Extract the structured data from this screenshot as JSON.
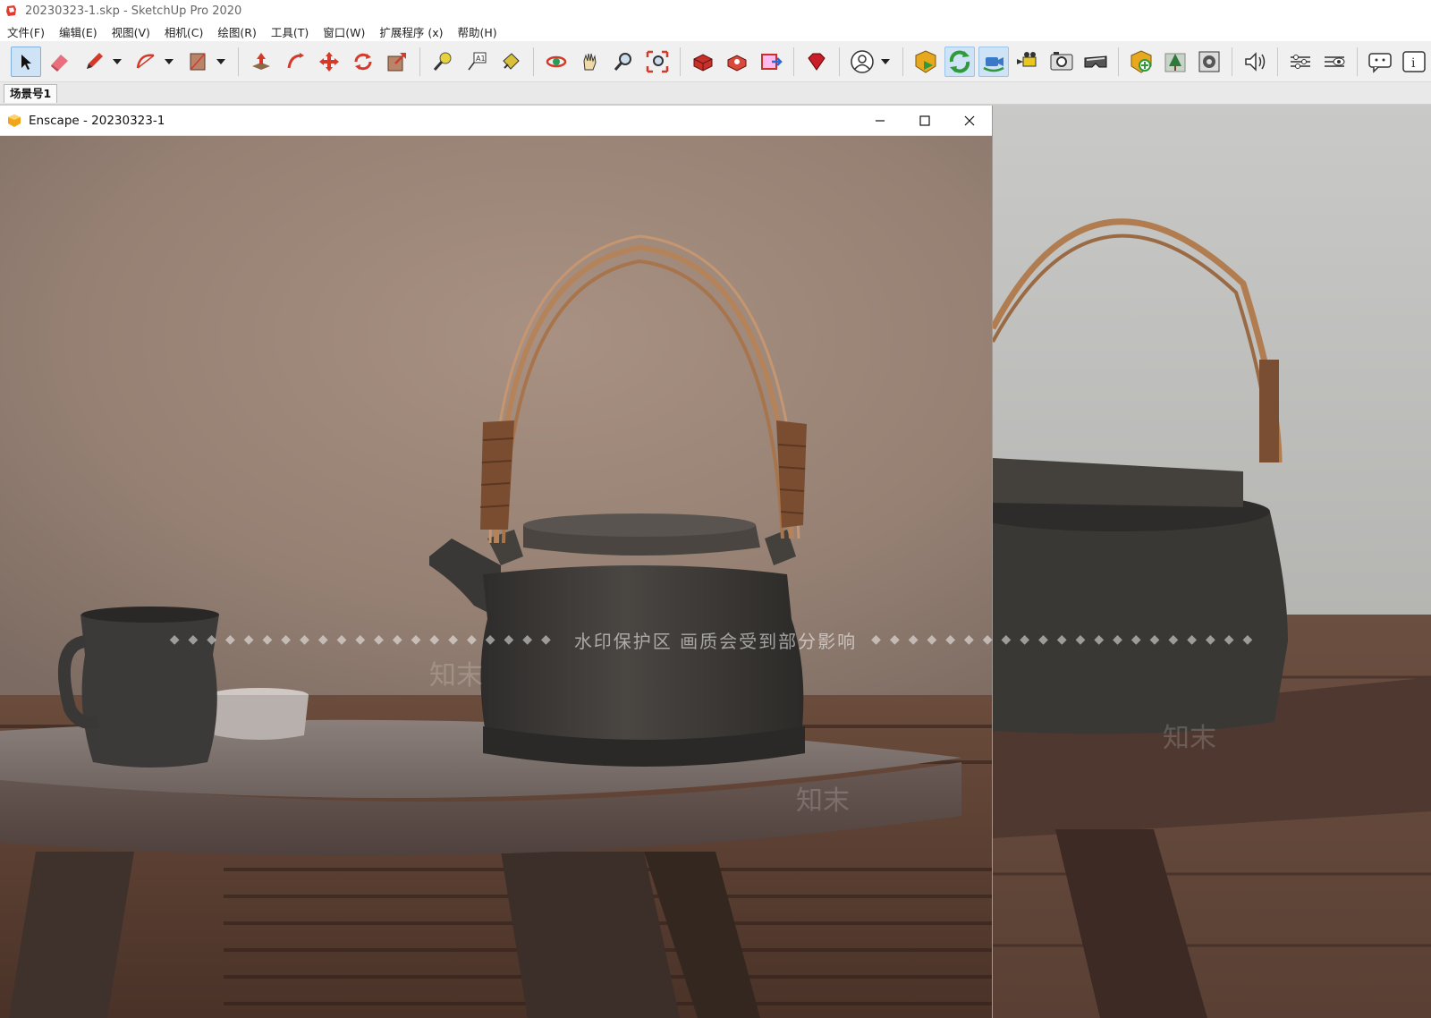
{
  "sketchup": {
    "title": "20230323-1.skp - SketchUp Pro 2020",
    "menus": [
      "文件(F)",
      "编辑(E)",
      "视图(V)",
      "相机(C)",
      "绘图(R)",
      "工具(T)",
      "窗口(W)",
      "扩展程序 (x)",
      "帮助(H)"
    ],
    "scene_tab": "场景号1",
    "toolbar_icons": [
      "select-icon",
      "eraser-icon",
      "pencil-icon",
      "arc-icon",
      "rectangle-icon",
      "push-pull-icon",
      "follow-me-icon",
      "move-icon",
      "rotate-icon",
      "scale-icon",
      "tape-measure-icon",
      "text-icon",
      "paint-bucket-icon",
      "orbit-icon",
      "pan-icon",
      "zoom-icon",
      "zoom-extents-icon",
      "warehouse-icon",
      "extension-warehouse-icon",
      "layout-icon",
      "ruby-icon",
      "user-icon",
      "enscape-start-icon",
      "enscape-sync-icon",
      "enscape-sync-views-icon",
      "enscape-video-icon",
      "enscape-screenshot-icon",
      "enscape-vr-icon",
      "enscape-asset-library-icon",
      "enscape-material-icon",
      "enscape-render-settings-icon",
      "enscape-sound-icon",
      "enscape-settings-icon",
      "enscape-visual-settings-icon",
      "enscape-feedback-icon",
      "enscape-about-icon"
    ]
  },
  "enscape": {
    "title": "Enscape - 20230323-1"
  },
  "watermark": {
    "text": "水印保护区  画质会受到部分影响",
    "brand": "知末"
  },
  "colors": {
    "active_tool_bg": "#cfe3f7",
    "wall": "#9c8676",
    "table": "#6e615d",
    "floor": "#4a352c",
    "handle": "#9b6a43",
    "pot": "#3a3835"
  }
}
